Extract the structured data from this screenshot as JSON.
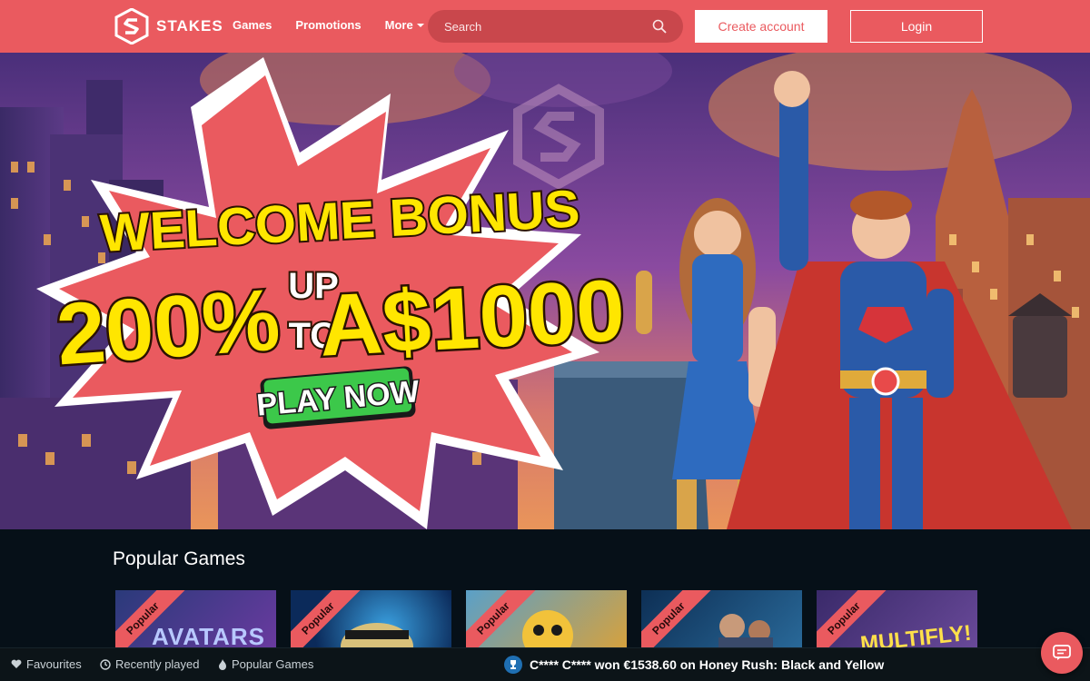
{
  "header": {
    "brand": "STAKES",
    "nav": [
      {
        "label": "Games"
      },
      {
        "label": "Promotions"
      },
      {
        "label": "More"
      }
    ],
    "search_placeholder": "Search",
    "create_account": "Create account",
    "login": "Login"
  },
  "hero": {
    "line1": "WELCOME BONUS",
    "amount_pct": "200%",
    "up": "UP",
    "to": "TO",
    "amount_cash": "A$1000",
    "cta": "PLAY NOW"
  },
  "popular": {
    "title": "Popular Games",
    "ribbon": "Popular",
    "games": [
      {
        "art": "AVATARS",
        "colors": [
          "#2a3a7a",
          "#6b3aa0"
        ]
      },
      {
        "art": "",
        "colors": [
          "#0b2a5a",
          "#1e5fa8"
        ]
      },
      {
        "art": "",
        "colors": [
          "#d9a13a",
          "#5aa0c8"
        ]
      },
      {
        "art": "",
        "colors": [
          "#0d2f55",
          "#2a6a9a"
        ]
      },
      {
        "art": "MULTIFLY!",
        "colors": [
          "#3a2a6a",
          "#e0b43a"
        ]
      }
    ]
  },
  "bottom": {
    "favourites": "Favourites",
    "recent": "Recently played",
    "popular_games": "Popular Games",
    "ticker": "C**** C**** won €1538.60 on Honey Rush: Black and Yellow"
  },
  "colors": {
    "brand": "#ea5a5f",
    "cta_green": "#3cc84a",
    "headline_yellow": "#ffe600"
  }
}
